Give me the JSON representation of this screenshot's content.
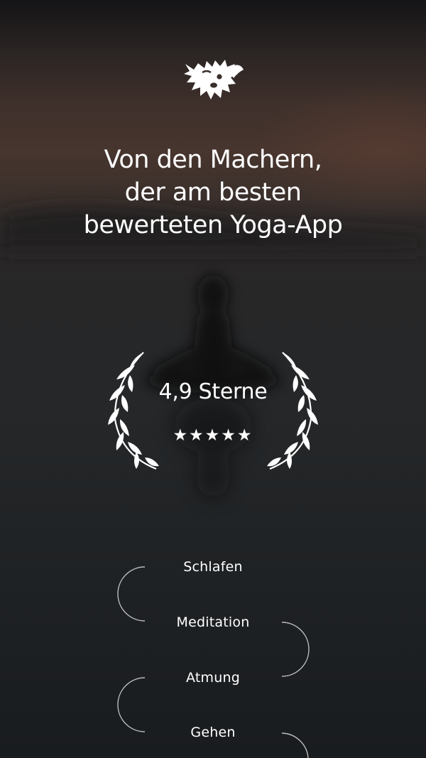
{
  "logo": {
    "icon": "dog-head-icon"
  },
  "headline": {
    "line1": "Von den Machern,",
    "line2": "der am besten",
    "line3": "bewerteten Yoga-App"
  },
  "rating": {
    "text": "4,9 Sterne",
    "stars": "★★★★★",
    "stars_count": 5
  },
  "categories": [
    "Schlafen",
    "Meditation",
    "Atmung",
    "Gehen"
  ]
}
